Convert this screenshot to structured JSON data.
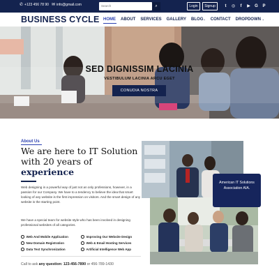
{
  "topbar": {
    "phone": "+123 456 78 90",
    "email": "info@gmail.com",
    "search_placeholder": "Search",
    "login": "Login",
    "signup": "Signup",
    "socials": [
      "twitter-icon",
      "instagram-icon",
      "facebook-icon",
      "youtube-icon",
      "google-plus-icon",
      "pinterest-icon"
    ]
  },
  "brand": {
    "name": "BUSINESS CYCLE"
  },
  "nav": {
    "items": [
      "HOME",
      "ABOUT",
      "SERVICES",
      "GALLERY",
      "BLOG",
      "CONTACT",
      "DROPDOWN"
    ]
  },
  "hero": {
    "title": "SED DIGNISSIM LACINIA",
    "subtitle": "VESTIBULUM LACINIA ARCU EGET",
    "button": "CONUDIA NOSTRA"
  },
  "about": {
    "eyebrow": "About Us",
    "heading_main": "We are here to IT Solution with 20 years of ",
    "heading_accent": "experience",
    "paragraph1": "Web designing in a powerful way of just not an only professions, however, in a passion for our Company. We have to a tendency to believe the idea that smart looking of any website is the first impression on visitors. And the smart design of any website is the starting point.",
    "paragraph2": "We have a special team for website style who has been involved in designing professional websites of all categories.",
    "features": [
      "Web And Mobile Application",
      "Improving Our Website Design",
      "New Domain Registration",
      "Web & Email Hosting Services",
      "Data Text Synchronization",
      "Artificial Intelligence Web App"
    ],
    "call_prefix": "Call to ask ",
    "call_bold": "any question: 123-456-7890",
    "call_suffix": " or 456-789-1430",
    "badge": "American IT Solutions Association AIA."
  },
  "colors": {
    "navy": "#14234f",
    "accent": "#2a3fb0",
    "badge": "#16255c"
  }
}
